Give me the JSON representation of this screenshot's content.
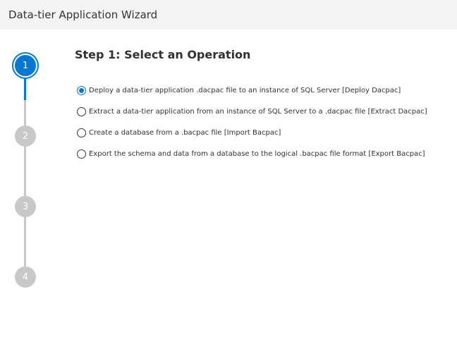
{
  "window": {
    "title": "Data-tier Application Wizard"
  },
  "stepper": {
    "steps": [
      {
        "number": "1",
        "state": "current"
      },
      {
        "number": "2",
        "state": "pending"
      },
      {
        "number": "3",
        "state": "pending"
      },
      {
        "number": "4",
        "state": "pending"
      }
    ]
  },
  "page": {
    "heading": "Step 1: Select an Operation",
    "selected_option": 0,
    "options": [
      {
        "label": "Deploy a data-tier application .dacpac file to an instance of SQL Server [Deploy Dacpac]",
        "checked": true
      },
      {
        "label": "Extract a data-tier application from an instance of SQL Server to a .dacpac file [Extract Dacpac]",
        "checked": false
      },
      {
        "label": "Create a database from a .bacpac file [Import Bacpac]",
        "checked": false
      },
      {
        "label": "Export the schema and data from a database to the logical .bacpac file format [Export Bacpac]",
        "checked": false
      }
    ]
  },
  "colors": {
    "accent": "#0078d4",
    "inactive_step": "#c8c8c8",
    "titlebar_bg": "#f4f4f4"
  }
}
